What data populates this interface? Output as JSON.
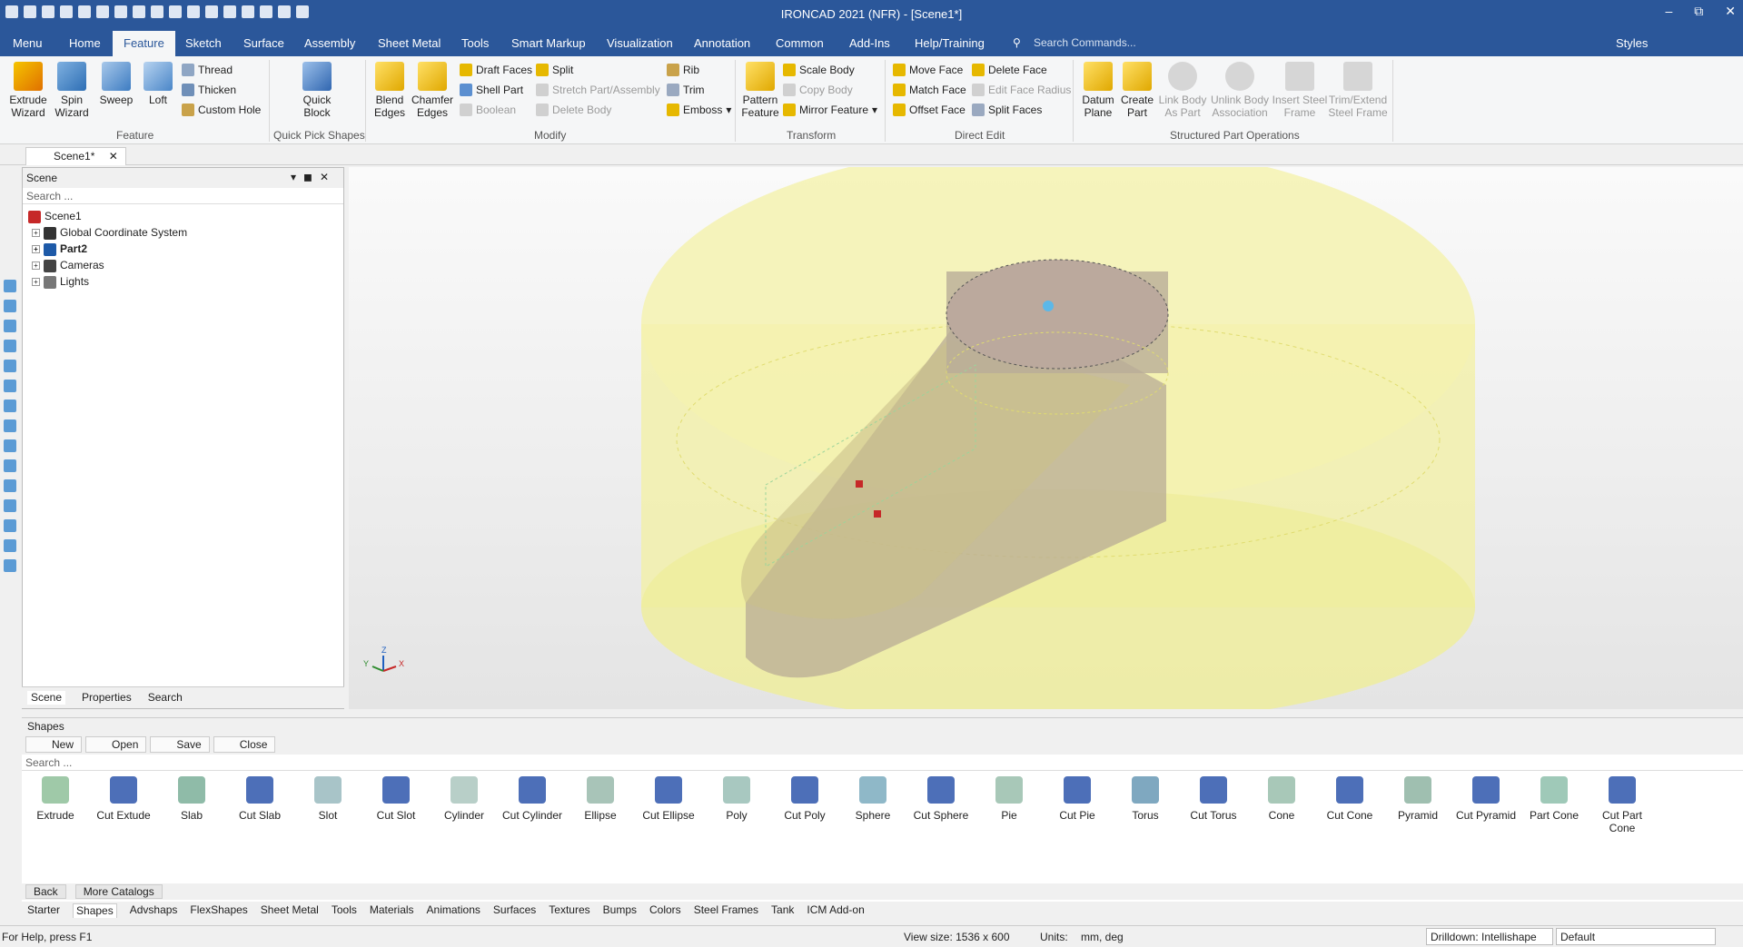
{
  "app": {
    "title": "IRONCAD 2021 (NFR) - [Scene1*]"
  },
  "menu": {
    "tabs": [
      {
        "label": "Menu"
      },
      {
        "label": "Home"
      },
      {
        "label": "Feature"
      },
      {
        "label": "Sketch"
      },
      {
        "label": "Surface"
      },
      {
        "label": "Assembly"
      },
      {
        "label": "Sheet Metal"
      },
      {
        "label": "Tools"
      },
      {
        "label": "Smart Markup"
      },
      {
        "label": "Visualization"
      },
      {
        "label": "Annotation"
      },
      {
        "label": "Common"
      },
      {
        "label": "Add-Ins"
      },
      {
        "label": "Help/Training"
      }
    ],
    "active": "Feature",
    "search_placeholder": "Search Commands...",
    "styles": "Styles"
  },
  "ribbon": {
    "feature": {
      "extrude_line1": "Extrude",
      "extrude_line2": "Wizard",
      "spin_line1": "Spin",
      "spin_line2": "Wizard",
      "sweep": "Sweep",
      "loft": "Loft",
      "thread": "Thread",
      "thicken": "Thicken",
      "custom_hole": "Custom Hole",
      "group": "Feature"
    },
    "quick": {
      "line1": "Quick",
      "line2": "Block",
      "group": "Quick Pick Shapes"
    },
    "modify": {
      "blend_line1": "Blend",
      "blend_line2": "Edges",
      "chamfer_line1": "Chamfer",
      "chamfer_line2": "Edges",
      "draft": "Draft Faces",
      "shell": "Shell Part",
      "boolean": "Boolean",
      "split": "Split",
      "stretch": "Stretch Part/Assembly",
      "delete_body": "Delete Body",
      "rib": "Rib",
      "trim": "Trim",
      "emboss": "Emboss",
      "group": "Modify"
    },
    "transform": {
      "pattern_line1": "Pattern",
      "pattern_line2": "Feature",
      "scale": "Scale Body",
      "copy": "Copy Body",
      "mirror": "Mirror Feature",
      "group": "Transform"
    },
    "direct": {
      "move": "Move Face",
      "match": "Match Face",
      "offset": "Offset Face",
      "delete": "Delete Face",
      "edit_radius": "Edit Face Radius",
      "split": "Split Faces",
      "group": "Direct Edit"
    },
    "structured": {
      "datum_line1": "Datum",
      "datum_line2": "Plane",
      "create_line1": "Create",
      "create_line2": "Part",
      "link_line1": "Link Body",
      "link_line2": "As Part",
      "unlink_line1": "Unlink Body",
      "unlink_line2": "Association",
      "insert_line1": "Insert Steel",
      "insert_line2": "Frame",
      "trim_line1": "Trim/Extend",
      "trim_line2": "Steel Frame",
      "group": "Structured Part Operations"
    }
  },
  "doc_tab": "Scene1*",
  "scene": {
    "title": "Scene",
    "search": "Search ...",
    "tree": [
      {
        "label": "Scene1"
      },
      {
        "label": "Global Coordinate System"
      },
      {
        "label": "Part2"
      },
      {
        "label": "Cameras"
      },
      {
        "label": "Lights"
      }
    ],
    "tabs": [
      "Scene",
      "Properties",
      "Search"
    ]
  },
  "axis": {
    "z": "Z",
    "y": "Y",
    "x": "X"
  },
  "shapes": {
    "title": "Shapes",
    "buttons": [
      "New",
      "Open",
      "Save",
      "Close"
    ],
    "search": "Search ...",
    "items": [
      "Extrude",
      "Cut Extude",
      "Slab",
      "Cut Slab",
      "Slot",
      "Cut Slot",
      "Cylinder",
      "Cut Cylinder",
      "Ellipse",
      "Cut Ellipse",
      "Poly",
      "Cut Poly",
      "Sphere",
      "Cut Sphere",
      "Pie",
      "Cut Pie",
      "Torus",
      "Cut Torus",
      "Cone",
      "Cut Cone",
      "Pyramid",
      "Cut Pyramid",
      "Part Cone",
      "Cut Part Cone"
    ],
    "back": "Back",
    "more": "More Catalogs",
    "catalogs": [
      "Starter",
      "Shapes",
      "Advshaps",
      "FlexShapes",
      "Sheet Metal",
      "Tools",
      "Materials",
      "Animations",
      "Surfaces",
      "Textures",
      "Bumps",
      "Colors",
      "Steel Frames",
      "Tank",
      "ICM Add-on"
    ]
  },
  "status": {
    "help": "For Help, press F1",
    "view_size": "View size: 1536 x  600",
    "units_label": "Units:",
    "units": "mm, deg",
    "drilldown": "Drilldown: Intellishape",
    "style": "Default"
  },
  "colors": {
    "titlebar": "#2b579a",
    "ghost_cylinder": "#f2f0a8",
    "part": "#b8ab96"
  }
}
